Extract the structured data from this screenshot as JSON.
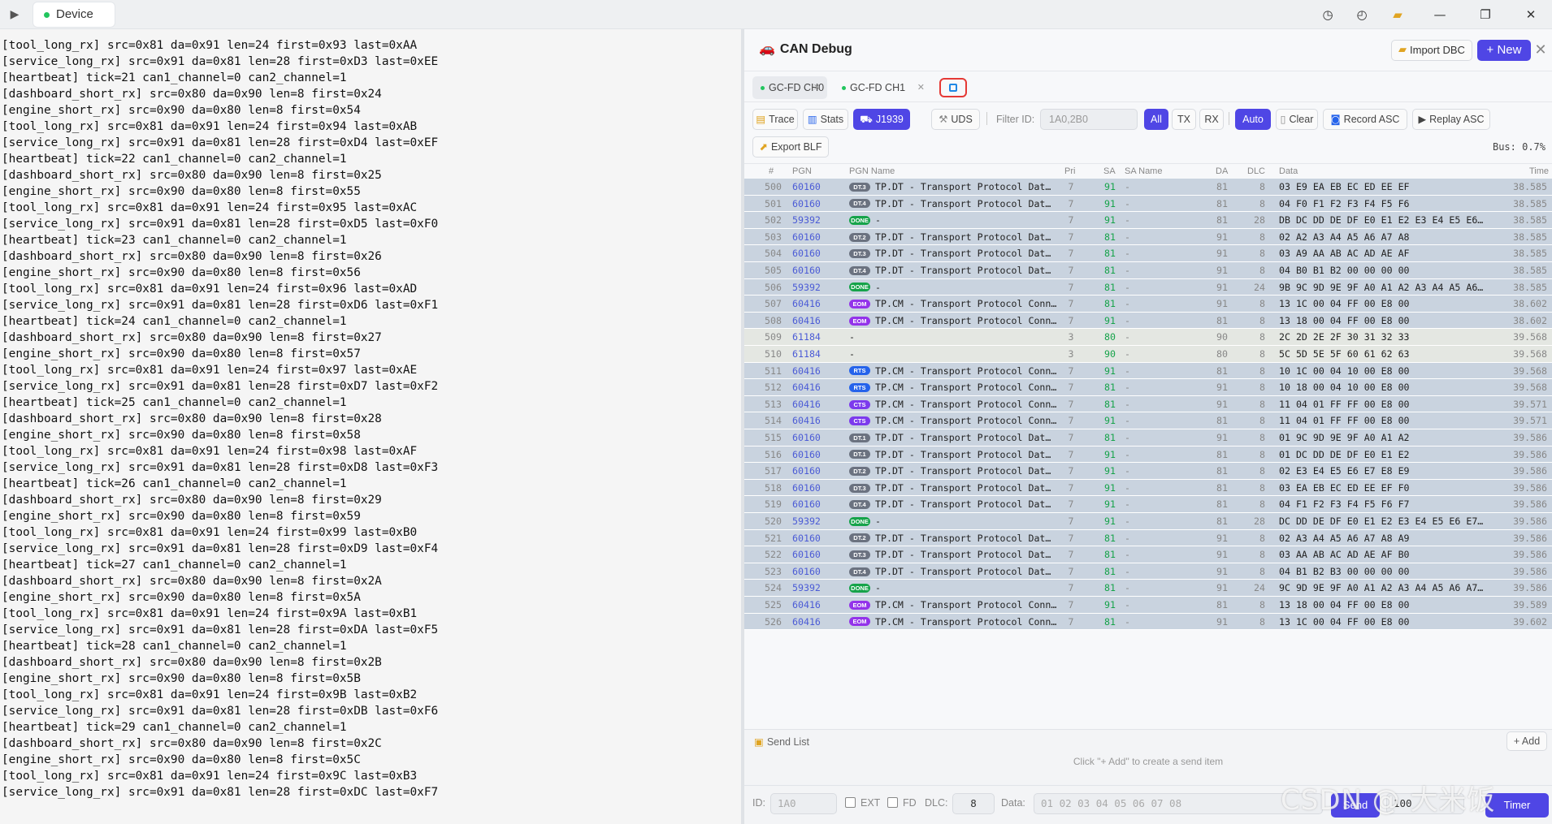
{
  "topbar": {
    "device_label": "Device",
    "icons": [
      "history-icon",
      "clock-icon",
      "folder-icon",
      "minimize-icon",
      "maximize-icon",
      "close-icon"
    ]
  },
  "terminal_lines": [
    "[tool_long_rx] src=0x81 da=0x91 len=24 first=0x93 last=0xAA",
    "[service_long_rx] src=0x91 da=0x81 len=28 first=0xD3 last=0xEE",
    "[heartbeat] tick=21 can1_channel=0 can2_channel=1",
    "[dashboard_short_rx] src=0x80 da=0x90 len=8 first=0x24",
    "[engine_short_rx] src=0x90 da=0x80 len=8 first=0x54",
    "[tool_long_rx] src=0x81 da=0x91 len=24 first=0x94 last=0xAB",
    "[service_long_rx] src=0x91 da=0x81 len=28 first=0xD4 last=0xEF",
    "[heartbeat] tick=22 can1_channel=0 can2_channel=1",
    "[dashboard_short_rx] src=0x80 da=0x90 len=8 first=0x25",
    "[engine_short_rx] src=0x90 da=0x80 len=8 first=0x55",
    "[tool_long_rx] src=0x81 da=0x91 len=24 first=0x95 last=0xAC",
    "[service_long_rx] src=0x91 da=0x81 len=28 first=0xD5 last=0xF0",
    "[heartbeat] tick=23 can1_channel=0 can2_channel=1",
    "[dashboard_short_rx] src=0x80 da=0x90 len=8 first=0x26",
    "[engine_short_rx] src=0x90 da=0x80 len=8 first=0x56",
    "[tool_long_rx] src=0x81 da=0x91 len=24 first=0x96 last=0xAD",
    "[service_long_rx] src=0x91 da=0x81 len=28 first=0xD6 last=0xF1",
    "[heartbeat] tick=24 can1_channel=0 can2_channel=1",
    "[dashboard_short_rx] src=0x80 da=0x90 len=8 first=0x27",
    "[engine_short_rx] src=0x90 da=0x80 len=8 first=0x57",
    "[tool_long_rx] src=0x81 da=0x91 len=24 first=0x97 last=0xAE",
    "[service_long_rx] src=0x91 da=0x81 len=28 first=0xD7 last=0xF2",
    "[heartbeat] tick=25 can1_channel=0 can2_channel=1",
    "[dashboard_short_rx] src=0x80 da=0x90 len=8 first=0x28",
    "[engine_short_rx] src=0x90 da=0x80 len=8 first=0x58",
    "[tool_long_rx] src=0x81 da=0x91 len=24 first=0x98 last=0xAF",
    "[service_long_rx] src=0x91 da=0x81 len=28 first=0xD8 last=0xF3",
    "[heartbeat] tick=26 can1_channel=0 can2_channel=1",
    "[dashboard_short_rx] src=0x80 da=0x90 len=8 first=0x29",
    "[engine_short_rx] src=0x90 da=0x80 len=8 first=0x59",
    "[tool_long_rx] src=0x81 da=0x91 len=24 first=0x99 last=0xB0",
    "[service_long_rx] src=0x91 da=0x81 len=28 first=0xD9 last=0xF4",
    "[heartbeat] tick=27 can1_channel=0 can2_channel=1",
    "[dashboard_short_rx] src=0x80 da=0x90 len=8 first=0x2A",
    "[engine_short_rx] src=0x90 da=0x80 len=8 first=0x5A",
    "[tool_long_rx] src=0x81 da=0x91 len=24 first=0x9A last=0xB1",
    "[service_long_rx] src=0x91 da=0x81 len=28 first=0xDA last=0xF5",
    "[heartbeat] tick=28 can1_channel=0 can2_channel=1",
    "[dashboard_short_rx] src=0x80 da=0x90 len=8 first=0x2B",
    "[engine_short_rx] src=0x90 da=0x80 len=8 first=0x5B",
    "[tool_long_rx] src=0x81 da=0x91 len=24 first=0x9B last=0xB2",
    "[service_long_rx] src=0x91 da=0x81 len=28 first=0xDB last=0xF6",
    "[heartbeat] tick=29 can1_channel=0 can2_channel=1",
    "[dashboard_short_rx] src=0x80 da=0x90 len=8 first=0x2C",
    "[engine_short_rx] src=0x90 da=0x80 len=8 first=0x5C",
    "[tool_long_rx] src=0x81 da=0x91 len=24 first=0x9C last=0xB3",
    "[service_long_rx] src=0x91 da=0x81 len=28 first=0xDC last=0xF7"
  ],
  "panel": {
    "title": "CAN Debug",
    "import_dbc_label": "Import DBC",
    "new_label": "+ New",
    "channel_tabs": [
      {
        "label": "GC-FD CH0",
        "active": true
      },
      {
        "label": "GC-FD CH1",
        "active": false
      }
    ],
    "toolbar": {
      "trace": "Trace",
      "stats": "Stats",
      "j1939": "J1939",
      "uds": "UDS",
      "filter_label": "Filter ID:",
      "filter_placeholder": "1A0,2B0",
      "all": "All",
      "tx": "TX",
      "rx": "RX",
      "auto": "Auto",
      "clear": "Clear",
      "record_asc": "Record ASC",
      "replay_asc": "Replay ASC",
      "export_blf": "Export BLF",
      "bus_load": "Bus: 0.7%"
    },
    "columns": [
      "#",
      "PGN",
      "PGN Name",
      "Pri",
      "SA",
      "SA Name",
      "DA",
      "DLC",
      "Data",
      "Time"
    ],
    "rows": [
      {
        "n": "500",
        "pgn": "60160",
        "badge": "DT.3",
        "name": "TP.DT - Transport Protocol Dat…",
        "pri": "7",
        "sa": "91",
        "saname": "-",
        "da": "81",
        "dlc": "8",
        "data": "03 E9 EA EB EC ED EE EF",
        "time": "38.585"
      },
      {
        "n": "501",
        "pgn": "60160",
        "badge": "DT.4",
        "name": "TP.DT - Transport Protocol Dat…",
        "pri": "7",
        "sa": "91",
        "saname": "-",
        "da": "81",
        "dlc": "8",
        "data": "04 F0 F1 F2 F3 F4 F5 F6",
        "time": "38.585"
      },
      {
        "n": "502",
        "pgn": "59392",
        "badge": "DONE",
        "name": "-",
        "pri": "7",
        "sa": "91",
        "saname": "-",
        "da": "81",
        "dlc": "28",
        "data": "DB DC DD DE DF E0 E1 E2 E3 E4 E5 E6…",
        "time": "38.585"
      },
      {
        "n": "503",
        "pgn": "60160",
        "badge": "DT.2",
        "name": "TP.DT - Transport Protocol Dat…",
        "pri": "7",
        "sa": "81",
        "saname": "-",
        "da": "91",
        "dlc": "8",
        "data": "02 A2 A3 A4 A5 A6 A7 A8",
        "time": "38.585"
      },
      {
        "n": "504",
        "pgn": "60160",
        "badge": "DT.3",
        "name": "TP.DT - Transport Protocol Dat…",
        "pri": "7",
        "sa": "81",
        "saname": "-",
        "da": "91",
        "dlc": "8",
        "data": "03 A9 AA AB AC AD AE AF",
        "time": "38.585"
      },
      {
        "n": "505",
        "pgn": "60160",
        "badge": "DT.4",
        "name": "TP.DT - Transport Protocol Dat…",
        "pri": "7",
        "sa": "81",
        "saname": "-",
        "da": "91",
        "dlc": "8",
        "data": "04 B0 B1 B2 00 00 00 00",
        "time": "38.585"
      },
      {
        "n": "506",
        "pgn": "59392",
        "badge": "DONE",
        "name": "-",
        "pri": "7",
        "sa": "81",
        "saname": "-",
        "da": "91",
        "dlc": "24",
        "data": "9B 9C 9D 9E 9F A0 A1 A2 A3 A4 A5 A6…",
        "time": "38.585"
      },
      {
        "n": "507",
        "pgn": "60416",
        "badge": "EOM",
        "name": "TP.CM - Transport Protocol Conn…",
        "pri": "7",
        "sa": "81",
        "saname": "-",
        "da": "91",
        "dlc": "8",
        "data": "13 1C 00 04 FF 00 E8 00",
        "time": "38.602"
      },
      {
        "n": "508",
        "pgn": "60416",
        "badge": "EOM",
        "name": "TP.CM - Transport Protocol Conn…",
        "pri": "7",
        "sa": "91",
        "saname": "-",
        "da": "81",
        "dlc": "8",
        "data": "13 18 00 04 FF 00 E8 00",
        "time": "38.602"
      },
      {
        "n": "509",
        "pgn": "61184",
        "badge": "",
        "name": "-",
        "pri": "3",
        "sa": "80",
        "saname": "-",
        "da": "90",
        "dlc": "8",
        "data": "2C 2D 2E 2F 30 31 32 33",
        "time": "39.568"
      },
      {
        "n": "510",
        "pgn": "61184",
        "badge": "",
        "name": "-",
        "pri": "3",
        "sa": "90",
        "saname": "-",
        "da": "80",
        "dlc": "8",
        "data": "5C 5D 5E 5F 60 61 62 63",
        "time": "39.568"
      },
      {
        "n": "511",
        "pgn": "60416",
        "badge": "RTS",
        "name": "TP.CM - Transport Protocol Conn…",
        "pri": "7",
        "sa": "91",
        "saname": "-",
        "da": "81",
        "dlc": "8",
        "data": "10 1C 00 04 10 00 E8 00",
        "time": "39.568"
      },
      {
        "n": "512",
        "pgn": "60416",
        "badge": "RTS",
        "name": "TP.CM - Transport Protocol Conn…",
        "pri": "7",
        "sa": "81",
        "saname": "-",
        "da": "91",
        "dlc": "8",
        "data": "10 18 00 04 10 00 E8 00",
        "time": "39.568"
      },
      {
        "n": "513",
        "pgn": "60416",
        "badge": "CTS",
        "name": "TP.CM - Transport Protocol Conn…",
        "pri": "7",
        "sa": "81",
        "saname": "-",
        "da": "91",
        "dlc": "8",
        "data": "11 04 01 FF FF 00 E8 00",
        "time": "39.571"
      },
      {
        "n": "514",
        "pgn": "60416",
        "badge": "CTS",
        "name": "TP.CM - Transport Protocol Conn…",
        "pri": "7",
        "sa": "91",
        "saname": "-",
        "da": "81",
        "dlc": "8",
        "data": "11 04 01 FF FF 00 E8 00",
        "time": "39.571"
      },
      {
        "n": "515",
        "pgn": "60160",
        "badge": "DT.1",
        "name": "TP.DT - Transport Protocol Dat…",
        "pri": "7",
        "sa": "81",
        "saname": "-",
        "da": "91",
        "dlc": "8",
        "data": "01 9C 9D 9E 9F A0 A1 A2",
        "time": "39.586"
      },
      {
        "n": "516",
        "pgn": "60160",
        "badge": "DT.1",
        "name": "TP.DT - Transport Protocol Dat…",
        "pri": "7",
        "sa": "91",
        "saname": "-",
        "da": "81",
        "dlc": "8",
        "data": "01 DC DD DE DF E0 E1 E2",
        "time": "39.586"
      },
      {
        "n": "517",
        "pgn": "60160",
        "badge": "DT.2",
        "name": "TP.DT - Transport Protocol Dat…",
        "pri": "7",
        "sa": "91",
        "saname": "-",
        "da": "81",
        "dlc": "8",
        "data": "02 E3 E4 E5 E6 E7 E8 E9",
        "time": "39.586"
      },
      {
        "n": "518",
        "pgn": "60160",
        "badge": "DT.3",
        "name": "TP.DT - Transport Protocol Dat…",
        "pri": "7",
        "sa": "91",
        "saname": "-",
        "da": "81",
        "dlc": "8",
        "data": "03 EA EB EC ED EE EF F0",
        "time": "39.586"
      },
      {
        "n": "519",
        "pgn": "60160",
        "badge": "DT.4",
        "name": "TP.DT - Transport Protocol Dat…",
        "pri": "7",
        "sa": "91",
        "saname": "-",
        "da": "81",
        "dlc": "8",
        "data": "04 F1 F2 F3 F4 F5 F6 F7",
        "time": "39.586"
      },
      {
        "n": "520",
        "pgn": "59392",
        "badge": "DONE",
        "name": "-",
        "pri": "7",
        "sa": "91",
        "saname": "-",
        "da": "81",
        "dlc": "28",
        "data": "DC DD DE DF E0 E1 E2 E3 E4 E5 E6 E7…",
        "time": "39.586"
      },
      {
        "n": "521",
        "pgn": "60160",
        "badge": "DT.2",
        "name": "TP.DT - Transport Protocol Dat…",
        "pri": "7",
        "sa": "81",
        "saname": "-",
        "da": "91",
        "dlc": "8",
        "data": "02 A3 A4 A5 A6 A7 A8 A9",
        "time": "39.586"
      },
      {
        "n": "522",
        "pgn": "60160",
        "badge": "DT.3",
        "name": "TP.DT - Transport Protocol Dat…",
        "pri": "7",
        "sa": "81",
        "saname": "-",
        "da": "91",
        "dlc": "8",
        "data": "03 AA AB AC AD AE AF B0",
        "time": "39.586"
      },
      {
        "n": "523",
        "pgn": "60160",
        "badge": "DT.4",
        "name": "TP.DT - Transport Protocol Dat…",
        "pri": "7",
        "sa": "81",
        "saname": "-",
        "da": "91",
        "dlc": "8",
        "data": "04 B1 B2 B3 00 00 00 00",
        "time": "39.586"
      },
      {
        "n": "524",
        "pgn": "59392",
        "badge": "DONE",
        "name": "-",
        "pri": "7",
        "sa": "81",
        "saname": "-",
        "da": "91",
        "dlc": "24",
        "data": "9C 9D 9E 9F A0 A1 A2 A3 A4 A5 A6 A7…",
        "time": "39.586"
      },
      {
        "n": "525",
        "pgn": "60416",
        "badge": "EOM",
        "name": "TP.CM - Transport Protocol Conn…",
        "pri": "7",
        "sa": "91",
        "saname": "-",
        "da": "81",
        "dlc": "8",
        "data": "13 18 00 04 FF 00 E8 00",
        "time": "39.589"
      },
      {
        "n": "526",
        "pgn": "60416",
        "badge": "EOM",
        "name": "TP.CM - Transport Protocol Conn…",
        "pri": "7",
        "sa": "81",
        "saname": "-",
        "da": "91",
        "dlc": "8",
        "data": "13 1C 00 04 FF 00 E8 00",
        "time": "39.602"
      }
    ],
    "badge_colors": {
      "DT": "#6b7280",
      "DONE": "#16a34a",
      "EOM": "#9333ea",
      "RTS": "#2563eb",
      "CTS": "#7c3aed"
    },
    "send_list": {
      "title": "Send List",
      "add_label": "+ Add",
      "hint": "Click \"+ Add\" to create a send item",
      "id_label": "ID:",
      "id_placeholder": "1A0",
      "ext_label": "EXT",
      "fd_label": "FD",
      "dlc_label": "DLC:",
      "dlc_value": "8",
      "data_label": "Data:",
      "data_placeholder": "01 02 03 04 05 06 07 08",
      "send_label": "Send",
      "interval_value": "100",
      "timer_label": "Timer"
    }
  },
  "watermark": "CSDN @ 大米饭"
}
